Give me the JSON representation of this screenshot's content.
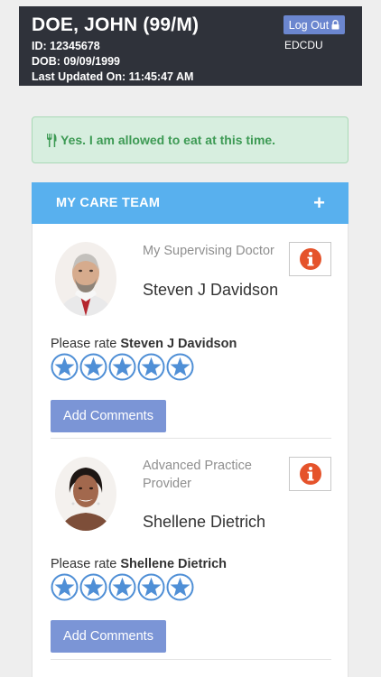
{
  "header": {
    "patient_name": "DOE, JOHN (99/M)",
    "id_line": "ID:  12345678",
    "dob_line": "DOB: 09/09/1999",
    "updated_line": "Last Updated On: 11:45:47 AM",
    "logout_label": "Log Out",
    "unit_code": "EDCDU"
  },
  "alert": {
    "text": "Yes. I am allowed to eat at this time.",
    "icon": "utensils-icon"
  },
  "care_team": {
    "title": "MY CARE TEAM",
    "expand_icon": "+",
    "rate_prefix": "Please rate",
    "providers": [
      {
        "role": "My Supervising Doctor",
        "name": "Steven J Davidson",
        "rating": 0,
        "add_comments_label": "Add Comments"
      },
      {
        "role": "Advanced Practice Provider",
        "name": "Shellene Dietrich",
        "rating": 0,
        "add_comments_label": "Add Comments"
      }
    ]
  },
  "colors": {
    "header_bg": "#2f323a",
    "alert_bg": "#d7eedf",
    "alert_text": "#3d9a54",
    "care_header_bg": "#58b0ee",
    "button_bg": "#7b95d6",
    "info_icon": "#e5532b",
    "star": "#4f8fd6"
  }
}
